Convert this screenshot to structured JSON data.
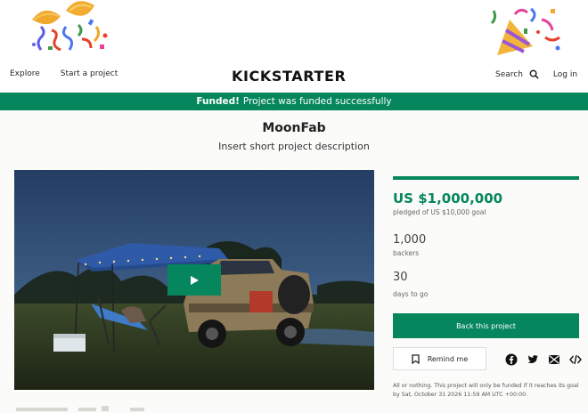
{
  "header": {
    "logo": "KICKSTARTER",
    "nav_left": [
      "Explore",
      "Start a project"
    ],
    "search_label": "Search",
    "login_label": "Log in"
  },
  "banner": {
    "strong": "Funded!",
    "text": "Project was funded successfully"
  },
  "project": {
    "title": "MoonFab",
    "description": "Insert short project description"
  },
  "stats": {
    "pledged": "US $1,000,000",
    "goal_text": "pledged of US $10,000 goal",
    "backers": "1,000",
    "backers_label": "backers",
    "days": "30",
    "days_label": "days to go",
    "funding_progress_percent": 100
  },
  "actions": {
    "back_label": "Back this project",
    "remind_label": "Remind me",
    "share_icons": [
      "facebook-icon",
      "twitter-icon",
      "email-icon",
      "embed-icon"
    ]
  },
  "fineprint": "All or nothing. This project will only be funded if it reaches its goal by Sat, October 31 2026 11:59 AM UTC +00:00.",
  "colors": {
    "brand_green": "#05865c",
    "text_dark": "#282828",
    "background": "#fbfbfa"
  }
}
